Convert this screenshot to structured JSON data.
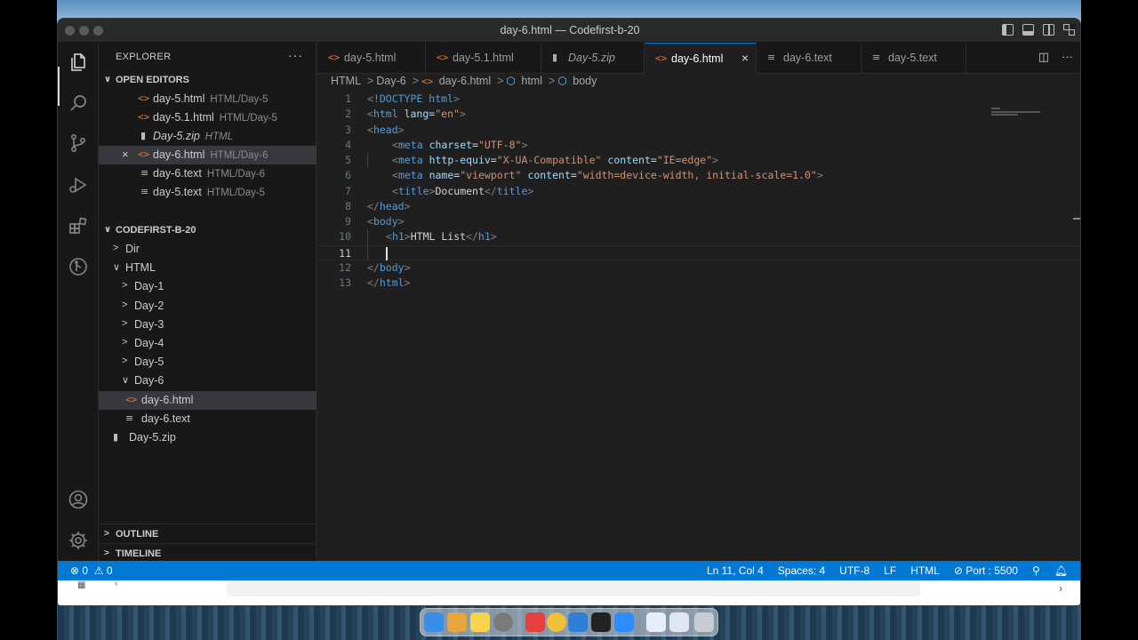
{
  "window": {
    "title": "day-6.html — Codefirst-b-20"
  },
  "activity_bar": {
    "items": [
      {
        "name": "explorer",
        "icon": "files-icon"
      },
      {
        "name": "search",
        "icon": "search-icon"
      },
      {
        "name": "source-control",
        "icon": "source-control-icon"
      },
      {
        "name": "run-debug",
        "icon": "run-debug-icon"
      },
      {
        "name": "extensions",
        "icon": "extensions-icon"
      },
      {
        "name": "git-graph",
        "icon": "git-graph-icon"
      }
    ],
    "bottom": [
      {
        "name": "accounts",
        "icon": "account-icon"
      },
      {
        "name": "manage",
        "icon": "gear-icon"
      }
    ]
  },
  "sidebar": {
    "title": "EXPLORER",
    "more": "···",
    "open_editors": {
      "title": "OPEN EDITORS",
      "items": [
        {
          "name": "day-5.html",
          "path": "HTML/Day-5",
          "icon": "<>",
          "italic": false
        },
        {
          "name": "day-5.1.html",
          "path": "HTML/Day-5",
          "icon": "<>",
          "italic": false
        },
        {
          "name": "Day-5.zip",
          "path": "HTML",
          "icon": "zip",
          "italic": true
        },
        {
          "name": "day-6.html",
          "path": "HTML/Day-6",
          "icon": "<>",
          "italic": false,
          "active": true,
          "close": "×"
        },
        {
          "name": "day-6.text",
          "path": "HTML/Day-6",
          "icon": "≡",
          "italic": false
        },
        {
          "name": "day-5.text",
          "path": "HTML/Day-5",
          "icon": "≡",
          "italic": false
        }
      ]
    },
    "workspace": {
      "title": "CODEFIRST-B-20",
      "tree": [
        {
          "label": "Dir",
          "chev": ">",
          "icon": ""
        },
        {
          "label": "HTML",
          "chev": "∨",
          "icon": ""
        },
        {
          "label": "Day-1",
          "chev": ">",
          "icon": ""
        },
        {
          "label": "Day-2",
          "chev": ">",
          "icon": ""
        },
        {
          "label": "Day-3",
          "chev": ">",
          "icon": ""
        },
        {
          "label": "Day-4",
          "chev": ">",
          "icon": ""
        },
        {
          "label": "Day-5",
          "chev": ">",
          "icon": ""
        },
        {
          "label": "Day-6",
          "chev": "∨",
          "icon": ""
        },
        {
          "label": "day-6.html",
          "chev": "",
          "icon": "<>"
        },
        {
          "label": "day-6.text",
          "chev": "",
          "icon": "≡"
        },
        {
          "label": "Day-5.zip",
          "chev": "",
          "icon": "zip"
        }
      ]
    },
    "outline": {
      "title": "OUTLINE"
    },
    "timeline": {
      "title": "TIMELINE"
    }
  },
  "tabs": [
    {
      "label": "day-5.html",
      "icon": "<>"
    },
    {
      "label": "day-5.1.html",
      "icon": "<>"
    },
    {
      "label": "Day-5.zip",
      "icon": "zip",
      "italic": true
    },
    {
      "label": "day-6.html",
      "icon": "<>",
      "active": true,
      "close": "×"
    },
    {
      "label": "day-6.text",
      "icon": "≡"
    },
    {
      "label": "day-5.text",
      "icon": "≡"
    }
  ],
  "breadcrumb": {
    "parts": [
      "HTML",
      "Day-6",
      "day-6.html",
      "html",
      "body"
    ],
    "separator": ">"
  },
  "editor": {
    "line_numbers": [
      "1",
      "2",
      "3",
      "4",
      "5",
      "6",
      "7",
      "8",
      "9",
      "10",
      "11",
      "12",
      "13"
    ],
    "current_line": 11,
    "lines": [
      "<!DOCTYPE html>",
      "<html lang=\"en\">",
      "<head>",
      "<meta charset=\"UTF-8\">",
      "<meta http-equiv=\"X-UA-Compatible\" content=\"IE=edge\">",
      "<meta name=\"viewport\" content=\"width=device-width, initial-scale=1.0\">",
      "<title>Document</title>",
      "</head>",
      "<body>",
      "<h1>HTML List</h1>",
      "",
      "</body>",
      "</html>"
    ]
  },
  "statusbar": {
    "errors": "0",
    "warnings": "0",
    "position": "Ln 11, Col 4",
    "spaces": "Spaces: 4",
    "encoding": "UTF-8",
    "eol": "LF",
    "language": "HTML",
    "port": "Port : 5500"
  },
  "colors": {
    "accent": "#0078d4",
    "html_icon": "#e37933",
    "tag": "#569cd6",
    "attr": "#9cdcfe",
    "string": "#ce9178"
  }
}
